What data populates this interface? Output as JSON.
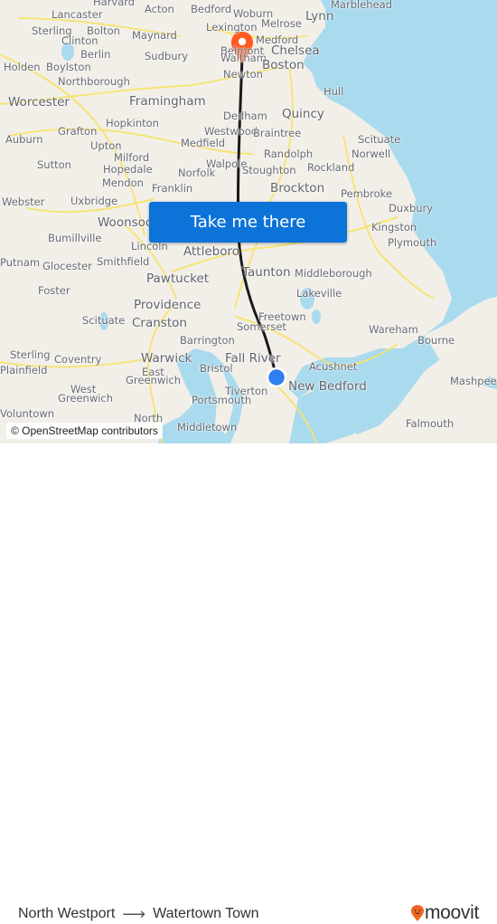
{
  "map": {
    "attribution": "© OpenStreetMap contributors",
    "colors": {
      "land": "#f2efe9",
      "water": "#aadaed",
      "roads": "#f7e36a",
      "route": "#1a1a1a",
      "origin": "#2f7ff0",
      "destination": "#ff5a1f"
    },
    "towns": [
      {
        "name": "Harvard",
        "big": false
      },
      {
        "name": "Acton",
        "big": false
      },
      {
        "name": "Bedford",
        "big": false
      },
      {
        "name": "Woburn",
        "big": false
      },
      {
        "name": "Lynn",
        "big": true
      },
      {
        "name": "Marblehead",
        "big": false
      },
      {
        "name": "Lancaster",
        "big": false
      },
      {
        "name": "Lexington",
        "big": false
      },
      {
        "name": "Melrose",
        "big": false
      },
      {
        "name": "Sterling",
        "big": false
      },
      {
        "name": "Bolton",
        "big": false
      },
      {
        "name": "Maynard",
        "big": false
      },
      {
        "name": "Clinton",
        "big": false
      },
      {
        "name": "Medford",
        "big": false
      },
      {
        "name": "Chelsea",
        "big": true
      },
      {
        "name": "Belmont",
        "big": false
      },
      {
        "name": "Berlin",
        "big": false
      },
      {
        "name": "Sudbury",
        "big": false
      },
      {
        "name": "Waltham",
        "big": false
      },
      {
        "name": "Boston",
        "big": true
      },
      {
        "name": "Holden",
        "big": false
      },
      {
        "name": "Boylston",
        "big": false
      },
      {
        "name": "Newton",
        "big": false
      },
      {
        "name": "Hull",
        "big": false
      },
      {
        "name": "Northborough",
        "big": false
      },
      {
        "name": "Worcester",
        "big": true
      },
      {
        "name": "Framingham",
        "big": true
      },
      {
        "name": "Dedham",
        "big": false
      },
      {
        "name": "Quincy",
        "big": true
      },
      {
        "name": "Hopkinton",
        "big": false
      },
      {
        "name": "Grafton",
        "big": false
      },
      {
        "name": "Westwood",
        "big": false
      },
      {
        "name": "Braintree",
        "big": false
      },
      {
        "name": "Auburn",
        "big": false
      },
      {
        "name": "Upton",
        "big": false
      },
      {
        "name": "Medfield",
        "big": false
      },
      {
        "name": "Scituate",
        "big": false
      },
      {
        "name": "Milford",
        "big": false
      },
      {
        "name": "Randolph",
        "big": false
      },
      {
        "name": "Norwell",
        "big": false
      },
      {
        "name": "Sutton",
        "big": false
      },
      {
        "name": "Walpole",
        "big": false
      },
      {
        "name": "Hopedale",
        "big": false
      },
      {
        "name": "Norfolk",
        "big": false
      },
      {
        "name": "Stoughton",
        "big": false
      },
      {
        "name": "Rockland",
        "big": false
      },
      {
        "name": "Mendon",
        "big": false
      },
      {
        "name": "Franklin",
        "big": false
      },
      {
        "name": "Brockton",
        "big": true
      },
      {
        "name": "Pembroke",
        "big": false
      },
      {
        "name": "Webster",
        "big": false
      },
      {
        "name": "Uxbridge",
        "big": false
      },
      {
        "name": "Duxbury",
        "big": false
      },
      {
        "name": "Woonsocket",
        "big": true
      },
      {
        "name": "Kingston",
        "big": false
      },
      {
        "name": "Bumillville",
        "big": false
      },
      {
        "name": "Lincoln",
        "big": false
      },
      {
        "name": "Plymouth",
        "big": false
      },
      {
        "name": "Attleboro",
        "big": true
      },
      {
        "name": "Putnam",
        "big": false
      },
      {
        "name": "Glocester",
        "big": false
      },
      {
        "name": "Smithfield",
        "big": false
      },
      {
        "name": "Taunton",
        "big": true
      },
      {
        "name": "Middleborough",
        "big": false
      },
      {
        "name": "Pawtucket",
        "big": true
      },
      {
        "name": "Foster",
        "big": false
      },
      {
        "name": "Lakeville",
        "big": false
      },
      {
        "name": "Providence",
        "big": true
      },
      {
        "name": "Freetown",
        "big": false
      },
      {
        "name": "Scituate",
        "big": false
      },
      {
        "name": "Cranston",
        "big": true
      },
      {
        "name": "Somerset",
        "big": false
      },
      {
        "name": "Wareham",
        "big": false
      },
      {
        "name": "Barrington",
        "big": false
      },
      {
        "name": "Bourne",
        "big": false
      },
      {
        "name": "Sterling",
        "big": false
      },
      {
        "name": "Coventry",
        "big": false
      },
      {
        "name": "Warwick",
        "big": true
      },
      {
        "name": "Fall River",
        "big": true
      },
      {
        "name": "Acushnet",
        "big": false
      },
      {
        "name": "Plainfield",
        "big": false
      },
      {
        "name": "East",
        "big": false
      },
      {
        "name": "Bristol",
        "big": false
      },
      {
        "name": "Greenwich",
        "big": false
      },
      {
        "name": "Mashpee",
        "big": false
      },
      {
        "name": "Tiverton",
        "big": false
      },
      {
        "name": "New Bedford",
        "big": true
      },
      {
        "name": "West",
        "big": false
      },
      {
        "name": "Greenwich",
        "big": false
      },
      {
        "name": "Portsmouth",
        "big": false
      },
      {
        "name": "Voluntown",
        "big": false
      },
      {
        "name": "North",
        "big": false
      },
      {
        "name": "Middletown",
        "big": false
      },
      {
        "name": "Falmouth",
        "big": false
      }
    ]
  },
  "cta": {
    "label": "Take me there"
  },
  "footer": {
    "origin": "North Westport",
    "arrow_icon": "right-arrow-icon",
    "destination": "Watertown Town",
    "brand": "moovit",
    "brand_color": "#f26522"
  }
}
